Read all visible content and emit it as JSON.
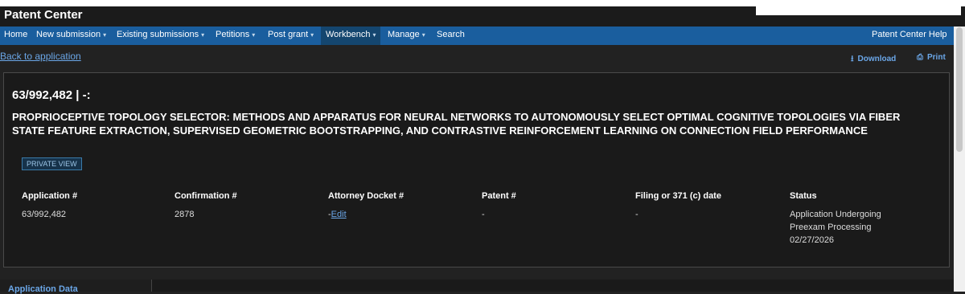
{
  "app": {
    "title": "Patent Center"
  },
  "nav": {
    "items": [
      {
        "label": "Home"
      },
      {
        "label": "New submission"
      },
      {
        "label": "Existing submissions"
      },
      {
        "label": "Petitions"
      },
      {
        "label": "Post grant"
      },
      {
        "label": "Workbench"
      },
      {
        "label": "Manage"
      },
      {
        "label": "Search"
      }
    ],
    "help": "Patent Center Help"
  },
  "actions": {
    "back": "Back to application",
    "download": "Download",
    "print": "Print"
  },
  "application": {
    "header": "63/992,482 | -:",
    "title": "PROPRIOCEPTIVE TOPOLOGY SELECTOR: METHODS AND APPARATUS FOR NEURAL NETWORKS TO AUTONOMOUSLY SELECT OPTIMAL COGNITIVE TOPOLOGIES VIA FIBER STATE FEATURE EXTRACTION, SUPERVISED GEOMETRIC BOOTSTRAPPING, AND CONTRASTIVE REINFORCEMENT LEARNING ON CONNECTION FIELD PERFORMANCE",
    "view_badge": "PRIVATE VIEW"
  },
  "details": {
    "application_label": "Application #",
    "application_value": "63/992,482",
    "confirmation_label": "Confirmation #",
    "confirmation_value": "2878",
    "docket_label": "Attorney Docket #",
    "docket_value": "-",
    "docket_edit": "Edit",
    "patent_label": "Patent #",
    "patent_value": "-",
    "filing_label": "Filing or 371 (c) date",
    "filing_value": "-",
    "status_label": "Status",
    "status_line1": "Application Undergoing",
    "status_line2": "Preexam Processing",
    "status_date": "02/27/2026"
  },
  "sidebar": {
    "heading": "Application Data"
  },
  "icons": {
    "download": "download-icon",
    "print": "print-icon",
    "caret": "chevron-down-icon"
  },
  "colors": {
    "nav": "#1a5e9e",
    "link": "#6ba7e8",
    "background": "#222222"
  }
}
